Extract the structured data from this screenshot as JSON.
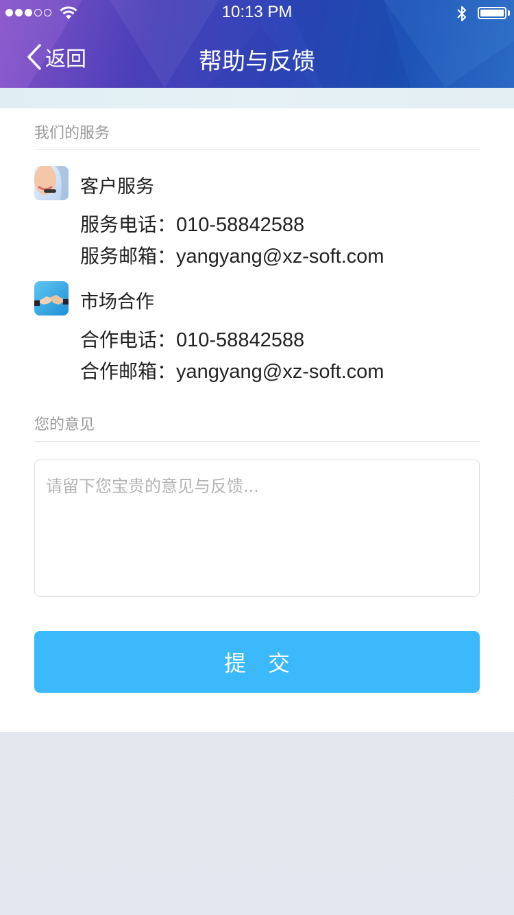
{
  "status_bar": {
    "signal_total": 5,
    "signal_filled": 3,
    "time": "10:13 PM",
    "battery_level": 1.0
  },
  "nav": {
    "back_label": "返回",
    "title": "帮助与反馈"
  },
  "services": {
    "section_label": "我们的服务",
    "groups": [
      {
        "icon": "customer-service-icon",
        "title": "客户服务",
        "phone_label": "服务电话：",
        "phone": "010-58842588",
        "email_label": "服务邮箱：",
        "email": "yangyang@xz-soft.com"
      },
      {
        "icon": "handshake-icon",
        "title": "市场合作",
        "phone_label": "合作电话：",
        "phone": "010-58842588",
        "email_label": "合作邮箱：",
        "email": "yangyang@xz-soft.com"
      }
    ]
  },
  "feedback": {
    "section_label": "您的意见",
    "placeholder": "请留下您宝贵的意见与反馈...",
    "value": "",
    "submit_label": "提交"
  },
  "colors": {
    "accent": "#3bb9fa",
    "header_start": "#7a45c4",
    "header_end": "#2a6ac4"
  }
}
